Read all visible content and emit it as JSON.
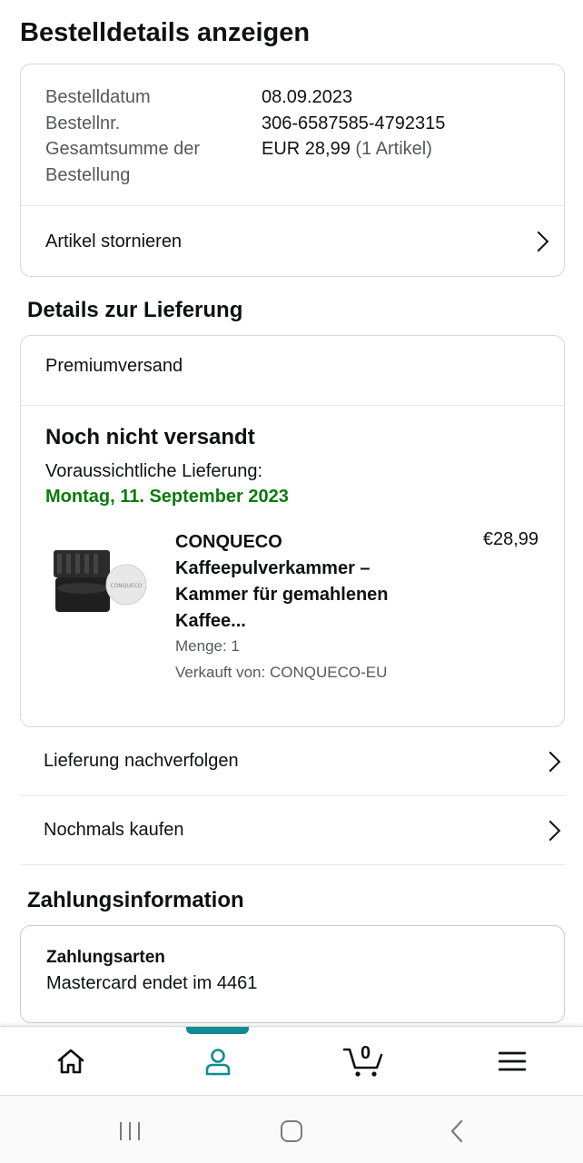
{
  "page": {
    "title": "Bestelldetails anzeigen"
  },
  "summary": {
    "rows": [
      {
        "label": "Bestelldatum",
        "value": "08.09.2023"
      },
      {
        "label": "Bestellnr.",
        "value": "306-6587585-4792315"
      },
      {
        "label": "Gesamtsumme der Bestellung",
        "value": "EUR 28,99",
        "value_suffix": "(1 Artikel)"
      }
    ],
    "cancel_label": "Artikel stornieren"
  },
  "delivery": {
    "section_title": "Details zur Lieferung",
    "shipping_method": "Premiumversand",
    "status": "Noch nicht versandt",
    "eta_label": "Voraussichtliche Lieferung:",
    "eta_date": "Montag, 11. September 2023",
    "item": {
      "title": "CONQUECO Kaffeepulverkammer – Kammer für gemahlenen Kaffee...",
      "price": "€28,99",
      "quantity": "Menge: 1",
      "seller": "Verkauft von: CONQUECO-EU",
      "image_icon": "product-image"
    },
    "track_label": "Lieferung nachverfolgen",
    "buy_again_label": "Nochmals kaufen"
  },
  "payment": {
    "section_title": "Zahlungsinformation",
    "method_title": "Zahlungsarten",
    "method_value": "Mastercard  endet im 4461"
  },
  "bottom_nav": {
    "items": [
      "home-icon",
      "account-icon",
      "cart-icon",
      "menu-icon"
    ],
    "active": "account-icon",
    "cart_count": "0",
    "accent_color": "#0f8c93"
  },
  "colors": {
    "eta_green": "#0b7a0b",
    "text": "#0f1111",
    "muted": "#565959"
  }
}
